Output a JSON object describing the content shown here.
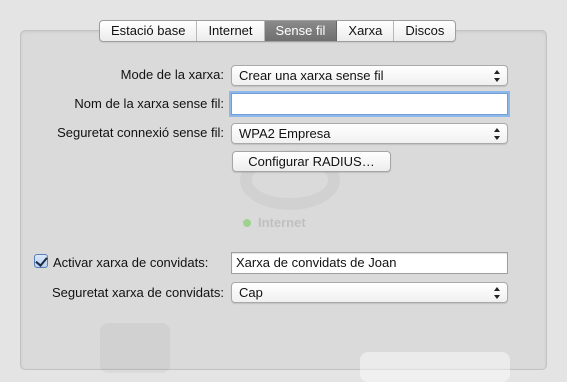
{
  "tabs": [
    {
      "label": "Estació base",
      "active": false
    },
    {
      "label": "Internet",
      "active": false
    },
    {
      "label": "Sense fil",
      "active": true
    },
    {
      "label": "Xarxa",
      "active": false
    },
    {
      "label": "Discos",
      "active": false
    }
  ],
  "background": {
    "internet_label": "Internet"
  },
  "form": {
    "network_mode": {
      "label": "Mode de la xarxa:",
      "value": "Crear una xarxa sense fil"
    },
    "network_name": {
      "label": "Nom de la xarxa sense fil:",
      "value": ""
    },
    "wireless_security": {
      "label": "Seguretat connexió sense fil:",
      "value": "WPA2 Empresa"
    },
    "radius_button": {
      "label": "Configurar RADIUS…"
    },
    "guest_network": {
      "label": "Activar xarxa de convidats:",
      "checked": true,
      "value": "Xarxa de convidats de Joan"
    },
    "guest_security": {
      "label": "Seguretat xarxa de convidats:",
      "value": "Cap"
    }
  },
  "colors": {
    "active_tab": "#7c7c7c",
    "focus_ring": "#8fb8ea",
    "panel_bg": "#dadada"
  }
}
